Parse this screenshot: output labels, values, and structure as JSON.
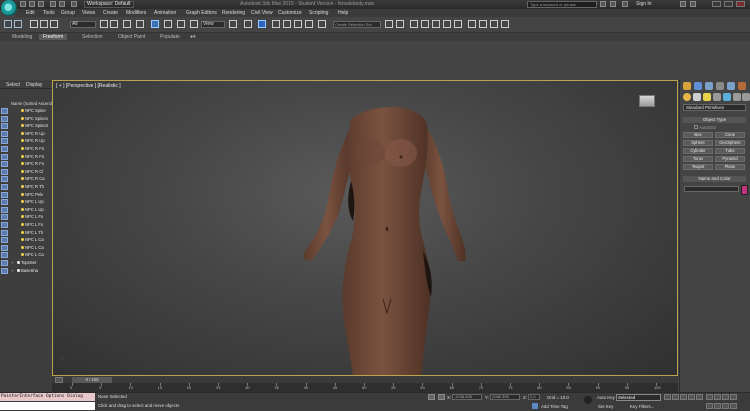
{
  "titlebar": {
    "workspace": "Workspace: Default",
    "document": "Autodesk 3ds Max 2015 - Student Version - femalebody.max",
    "search_placeholder": "Type a keyword or phrase",
    "signin": "Sign In"
  },
  "menus": [
    "Edit",
    "Tools",
    "Group",
    "Views",
    "Create",
    "Modifiers",
    "Animation",
    "Graph Editors",
    "Rendering",
    "Civil View",
    "Customize",
    "Scripting",
    "Help"
  ],
  "toolbar": {
    "selection_filter": "All",
    "reference_coord": "View",
    "selection_set_placeholder": "Create Selection Set"
  },
  "ribbon_tabs": [
    "Modeling",
    "Freeform",
    "Selection",
    "Object Paint",
    "Populate"
  ],
  "ribbon_active": "Freeform",
  "scene_explorer": {
    "tabs": [
      "Select",
      "Display"
    ],
    "column_header": "Name (Sorted Ascending)",
    "items": [
      "NPC Spine",
      "NPC Spine1",
      "NPC Spine2",
      "NPC R Up",
      "NPC R Up",
      "NPC R Fo",
      "NPC R Fo",
      "NPC R Fo",
      "NPC R Cl",
      "NPC R Ca",
      "NPC R Th",
      "NPC Pelv",
      "NPC L Up",
      "NPC L Up",
      "NPC L Fo",
      "NPC L Fo",
      "NPC L Th",
      "NPC L Ca",
      "NPC L Ca",
      "NPC L Ca",
      "TopsSet",
      "BaseSha"
    ]
  },
  "viewport": {
    "label": "[ + ] [Perspective ] [Realistic ]"
  },
  "command_panel": {
    "category": "Standard Primitives",
    "object_type_header": "Object Type",
    "autogrid_label": "AutoGrid",
    "primitives": [
      "Box",
      "Cone",
      "Sphere",
      "GeoSphere",
      "Cylinder",
      "Tube",
      "Torus",
      "Pyramid",
      "Teapot",
      "Plane"
    ],
    "name_color_header": "Name and Color",
    "object_color": "#c0327a"
  },
  "timeline": {
    "frame_slider": "0 / 100",
    "ticks": [
      "0",
      "5",
      "10",
      "15",
      "20",
      "25",
      "30",
      "35",
      "40",
      "45",
      "50",
      "55",
      "60",
      "65",
      "70",
      "75",
      "80",
      "85",
      "90",
      "95",
      "100"
    ]
  },
  "statusbar": {
    "listener": "PainterInterface Options Dialog",
    "selection_status": "None Selected",
    "prompt": "Click and drag to select and move objects",
    "x_label": "X:",
    "x_value": "-1038.826",
    "y_label": "Y:",
    "y_value": "2086.398",
    "z_label": "Z:",
    "z_value": "0.0",
    "grid": "Grid = 10.0",
    "add_time_tag": "Add Time Tag",
    "auto_key": "Auto Key",
    "set_key": "Set Key",
    "key_mode": "Selected",
    "key_filters": "Key Filters..."
  }
}
